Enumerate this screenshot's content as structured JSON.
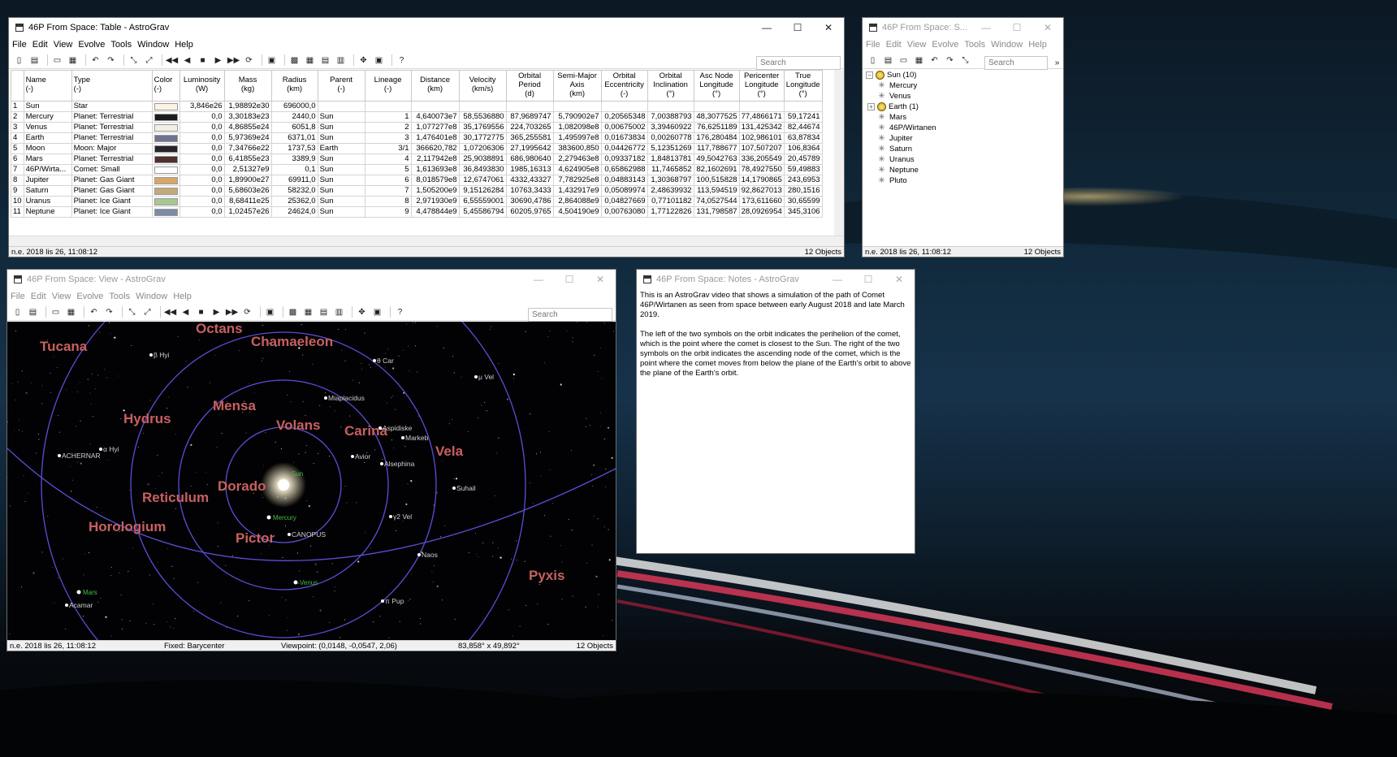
{
  "menus": [
    "File",
    "Edit",
    "View",
    "Evolve",
    "Tools",
    "Window",
    "Help"
  ],
  "table_window": {
    "title": "46P From Space: Table - AstroGrav",
    "search_placeholder": "Search",
    "columns": [
      [
        "Name",
        "(-)"
      ],
      [
        "Type",
        "(-)"
      ],
      [
        "Color",
        "(-)"
      ],
      [
        "Luminosity",
        "(W)"
      ],
      [
        "Mass",
        "(kg)"
      ],
      [
        "Radius",
        "(km)"
      ],
      [
        "Parent",
        "(-)"
      ],
      [
        "Lineage",
        "(-)"
      ],
      [
        "Distance",
        "(km)"
      ],
      [
        "Velocity",
        "(km/s)"
      ],
      [
        "Orbital",
        "Period",
        "(d)"
      ],
      [
        "Semi-Major",
        "Axis",
        "(km)"
      ],
      [
        "Orbital",
        "Eccentricity",
        "(-)"
      ],
      [
        "Orbital",
        "Inclination",
        "(°)"
      ],
      [
        "Asc Node",
        "Longitude",
        "(°)"
      ],
      [
        "Pericenter",
        "Longitude",
        "(°)"
      ],
      [
        "True",
        "Longitude",
        "(°)"
      ]
    ],
    "rows": [
      {
        "num": "1",
        "cells": [
          "Sun",
          "Star",
          "",
          "3,846e26",
          "1,98892e30",
          "696000,0",
          "",
          "",
          "",
          "",
          "",
          "",
          "",
          "",
          "",
          "",
          ""
        ]
      },
      {
        "num": "2",
        "cells": [
          "Mercury",
          "Planet: Terrestrial",
          "",
          "0,0",
          "3,30183e23",
          "2440,0",
          "Sun",
          "1",
          "4,640073e7",
          "58,5536880",
          "87,9689747",
          "5,790902e7",
          "0,20565348",
          "7,00388793",
          "48,3077525",
          "77,4866171",
          "59,17241"
        ]
      },
      {
        "num": "3",
        "cells": [
          "Venus",
          "Planet: Terrestrial",
          "",
          "0,0",
          "4,86855e24",
          "6051,8",
          "Sun",
          "2",
          "1,077277e8",
          "35,1769556",
          "224,703265",
          "1,082098e8",
          "0,00675002",
          "3,39460922",
          "76,6251189",
          "131,425342",
          "82,44674"
        ]
      },
      {
        "num": "4",
        "cells": [
          "Earth",
          "Planet: Terrestrial",
          "",
          "0,0",
          "5,97369e24",
          "6371,01",
          "Sun",
          "3",
          "1,476401e8",
          "30,1772775",
          "365,255581",
          "1,495997e8",
          "0,01673834",
          "0,00260778",
          "176,280484",
          "102,986101",
          "63,87834"
        ]
      },
      {
        "num": "5",
        "cells": [
          "Moon",
          "Moon: Major",
          "",
          "0,0",
          "7,34766e22",
          "1737,53",
          "Earth",
          "3/1",
          "366620,782",
          "1,07206306",
          "27,1995642",
          "383600,850",
          "0,04426772",
          "5,12351269",
          "117,788677",
          "107,507207",
          "106,8364"
        ]
      },
      {
        "num": "6",
        "cells": [
          "Mars",
          "Planet: Terrestrial",
          "",
          "0,0",
          "6,41855e23",
          "3389,9",
          "Sun",
          "4",
          "2,117942e8",
          "25,9038891",
          "686,980640",
          "2,279463e8",
          "0,09337182",
          "1,84813781",
          "49,5042763",
          "336,205549",
          "20,45789"
        ]
      },
      {
        "num": "7",
        "cells": [
          "46P/Wirta...",
          "Comet: Small",
          "",
          "0,0",
          "2,51327e9",
          "0,1",
          "Sun",
          "5",
          "1,613693e8",
          "36,8493830",
          "1985,16313",
          "4,624905e8",
          "0,65862988",
          "11,7465852",
          "82,1602691",
          "78,4927550",
          "59,49883"
        ]
      },
      {
        "num": "8",
        "cells": [
          "Jupiter",
          "Planet: Gas Giant",
          "",
          "0,0",
          "1,89900e27",
          "69911,0",
          "Sun",
          "6",
          "8,018579e8",
          "12,6747061",
          "4332,43327",
          "7,782925e8",
          "0,04883143",
          "1,30368797",
          "100,515828",
          "14,1790865",
          "243,6953"
        ]
      },
      {
        "num": "9",
        "cells": [
          "Saturn",
          "Planet: Gas Giant",
          "",
          "0,0",
          "5,68603e26",
          "58232,0",
          "Sun",
          "7",
          "1,505200e9",
          "9,15126284",
          "10763,3433",
          "1,432917e9",
          "0,05089974",
          "2,48639932",
          "113,594519",
          "92,8627013",
          "280,1516"
        ]
      },
      {
        "num": "10",
        "cells": [
          "Uranus",
          "Planet: Ice Giant",
          "",
          "0,0",
          "8,68411e25",
          "25362,0",
          "Sun",
          "8",
          "2,971930e9",
          "6,55559001",
          "30690,4786",
          "2,864088e9",
          "0,04827669",
          "0,77101182",
          "74,0527544",
          "173,611660",
          "30,65599"
        ]
      },
      {
        "num": "11",
        "cells": [
          "Neptune",
          "Planet: Ice Giant",
          "",
          "0,0",
          "1,02457e26",
          "24624,0",
          "Sun",
          "9",
          "4,478844e9",
          "5,45586794",
          "60205,9765",
          "4,504190e9",
          "0,00763080",
          "1,77122826",
          "131,798587",
          "28,0926954",
          "345,3106"
        ]
      }
    ],
    "row_colors": [
      "#fbf3e4",
      "#1c1c1c",
      "#f3f0e3",
      "#6f7293",
      "#262424",
      "#4e312c",
      "#ffffff",
      "#d8a66a",
      "#c4a97a",
      "#a8c794",
      "#7d8aa6"
    ],
    "status_left": "n.e. 2018 lis 26, 11:08:12",
    "status_right": "12 Objects"
  },
  "tree_window": {
    "title": "46P From Space: S...",
    "search_placeholder": "Search",
    "root": "Sun (10)",
    "root_expander": "−",
    "items": [
      {
        "label": "Mercury",
        "expander": ""
      },
      {
        "label": "Venus",
        "expander": ""
      },
      {
        "label": "Earth (1)",
        "expander": "+"
      },
      {
        "label": "Mars",
        "expander": ""
      },
      {
        "label": "46P/Wirtanen",
        "expander": ""
      },
      {
        "label": "Jupiter",
        "expander": ""
      },
      {
        "label": "Saturn",
        "expander": ""
      },
      {
        "label": "Uranus",
        "expander": ""
      },
      {
        "label": "Neptune",
        "expander": ""
      },
      {
        "label": "Pluto",
        "expander": ""
      }
    ],
    "status_left": "n.e. 2018 lis 26, 11:08:12",
    "status_right": "12 Objects"
  },
  "view_window": {
    "title": "46P From Space: View - AstroGrav",
    "search_placeholder": "Search",
    "constellations": [
      "Tucana",
      "Octans",
      "Chamaeleon",
      "Hydrus",
      "Mensa",
      "Volans",
      "Carina",
      "Vela",
      "Reticulum",
      "Dorado",
      "Horologium",
      "Pictor",
      "Pyxis"
    ],
    "stars": [
      "β Hyi",
      "θ Car",
      "μ Vel",
      "Miaplacidus",
      "Aspidiske",
      "Markeb",
      "ACHERNAR",
      "α Hyi",
      "Avior",
      "Alsephina",
      "Suhail",
      "γ2 Vel",
      "CANOPUS",
      "Naos",
      "Acamar",
      "π Pup"
    ],
    "bodies": [
      "Sun",
      "Mercury",
      "Venus",
      "Mars"
    ],
    "status": {
      "time": "n.e. 2018 lis 26, 11:08:12",
      "fixed": "Fixed: Barycenter",
      "viewpoint": "Viewpoint: (0,0148, -0,0547, 2,06)",
      "fov": "83,858° x 49,892°",
      "objects": "12 Objects"
    }
  },
  "notes_window": {
    "title": "46P From Space: Notes - AstroGrav",
    "paragraph1": "This is an AstroGrav video that shows a simulation of the path of Comet 46P/Wirtanen as seen from space between early August 2018 and late March 2019.",
    "paragraph2": "The left of the two symbols on the orbit indicates the perihelion of the comet, which is the point where the comet is closest to the Sun. The right of the two symbols on the orbit indicates the ascending node of the comet, which is the point where the comet moves from below the plane of the Earth's orbit to above the plane of the Earth's orbit."
  },
  "window_controls": {
    "minimize": "—",
    "maximize": "☐",
    "close": "✕"
  },
  "colors": {
    "constellation": "#c86060",
    "orbit": "#5a4fd8",
    "star_label": "#d0d0d0",
    "body_label": "#40c040"
  }
}
